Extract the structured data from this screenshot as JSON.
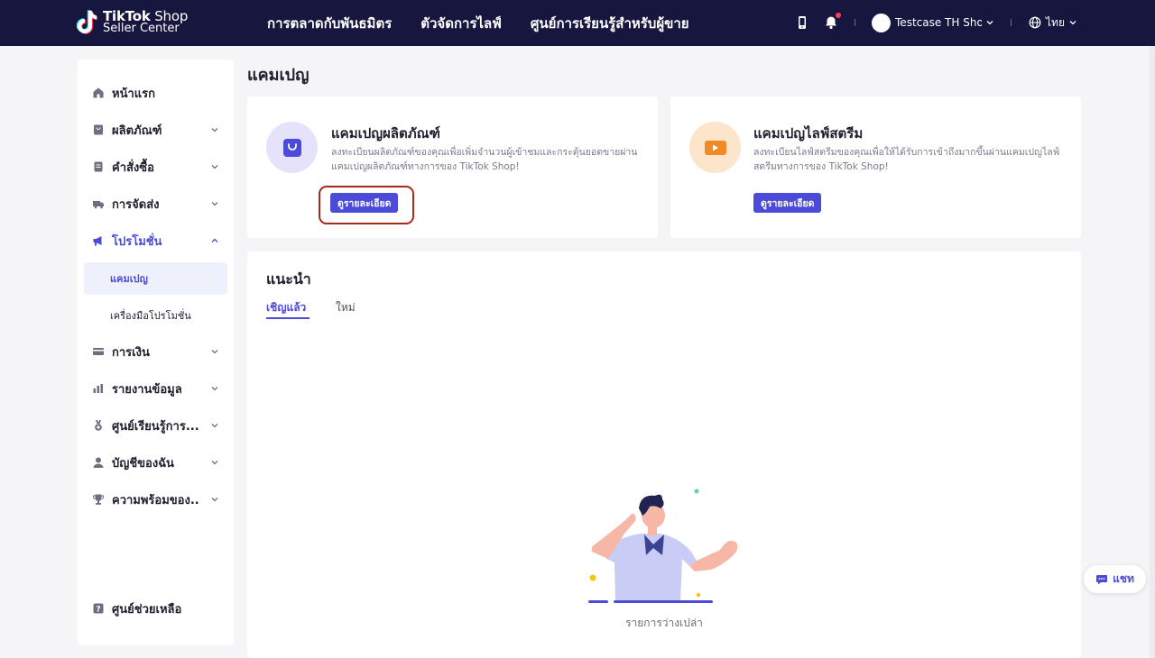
{
  "header": {
    "logo_line1_bold": "TikTok",
    "logo_line1_rest": " Shop",
    "logo_line2": "Seller Center",
    "nav": [
      {
        "label": "การตลาดกับพันธมิตร"
      },
      {
        "label": "ตัวจัดการไลฟ์"
      },
      {
        "label": "ศูนย์การเรียนรู้สำหรับผู้ขาย"
      }
    ],
    "shop_name": "Testcase TH Shop W",
    "language": "ไทย"
  },
  "sidebar": {
    "items": [
      {
        "label": "หน้าแรก",
        "icon": "home-icon"
      },
      {
        "label": "ผลิตภัณฑ์",
        "icon": "product-icon"
      },
      {
        "label": "คำสั่งซื้อ",
        "icon": "order-icon"
      },
      {
        "label": "การจัดส่ง",
        "icon": "truck-icon"
      },
      {
        "label": "โปรโมชั่น",
        "icon": "megaphone-icon"
      },
      {
        "label": "การเงิน",
        "icon": "card-icon"
      },
      {
        "label": "รายงานข้อมูล",
        "icon": "chart-icon"
      },
      {
        "label": "ศูนย์เรียนรู้การ...",
        "icon": "medal-icon"
      },
      {
        "label": "บัญชีของฉัน",
        "icon": "user-icon"
      },
      {
        "label": "ความพร้อมของ...",
        "icon": "trophy-icon"
      }
    ],
    "promo_sub": [
      {
        "label": "แคมเปญ"
      },
      {
        "label": "เครื่องมือโปรโมชั่น"
      }
    ],
    "help": "ศูนย์ช่วยเหลือ"
  },
  "main": {
    "page_title": "แคมเปญ",
    "cards": [
      {
        "title": "แคมเปญผลิตภัณฑ์",
        "desc_line1": "ลงทะเบียนผลิตภัณฑ์ของคุณเพื่อเพิ่มจำนวนผู้เข้าชมและกระตุ้นยอดขายผ่าน",
        "desc_line2": "แคมเปญผลิตภัณฑ์ทางการของ TikTok Shop!",
        "button": "ดูรายละเอียด",
        "icon": "shopping-bag-icon",
        "icon_bg": "#e4e3fb",
        "icon_color": "#4c4ad8"
      },
      {
        "title": "แคมเปญไลฟ์สตรีม",
        "desc_line1": "ลงทะเบียนไลฟ์สตรีมของคุณเพื่อให้ได้รับการเข้าถึงมากขึ้นผ่านแคมเปญไลฟ์",
        "desc_line2": "สตรีมทางการของ TikTok Shop!",
        "button": "ดูรายละเอียด",
        "icon": "video-icon",
        "icon_bg": "#fde5cc",
        "icon_color": "#f08a24"
      }
    ],
    "recommend_title": "แนะนำ",
    "tabs": [
      {
        "label": "เชิญแล้ว",
        "active": true
      },
      {
        "label": "ใหม่",
        "active": false
      }
    ],
    "empty_text": "รายการว่างเปล่า"
  },
  "chat": {
    "label": "แชท"
  },
  "colors": {
    "brand": "#4c4ad8",
    "topbar": "#16163f",
    "highlight": "#a8291c"
  }
}
